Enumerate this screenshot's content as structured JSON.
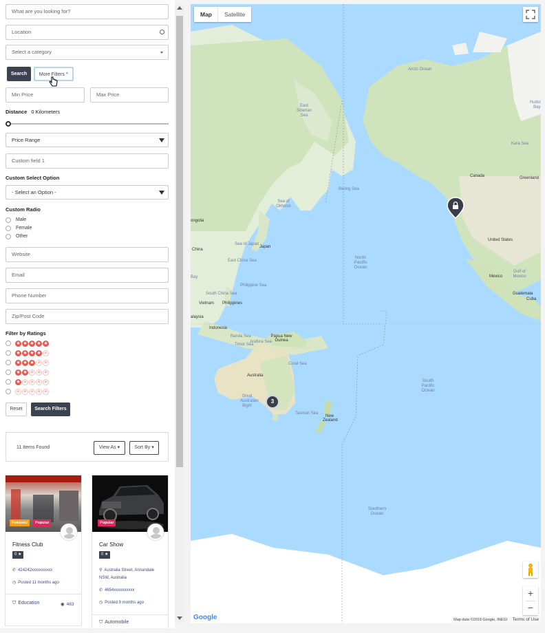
{
  "search": {
    "keyword_placeholder": "What are you looking for?",
    "location_placeholder": "Location",
    "category_placeholder": "Select a category",
    "search_label": "Search",
    "more_filters_label": "More Filters"
  },
  "filters": {
    "min_price_placeholder": "Min Price",
    "max_price_placeholder": "Max Price",
    "distance_label": "Distance",
    "distance_value": "0 Kilometers",
    "price_range_label": "Price Range",
    "custom_field_placeholder": "Custom field 1",
    "custom_select_heading": "Custom Select Option",
    "custom_select_value": "- Select an Option -",
    "custom_radio_heading": "Custom Radio",
    "radio_options": [
      "Male",
      "Female",
      "Other"
    ],
    "website_placeholder": "Website",
    "email_placeholder": "Email",
    "phone_placeholder": "Phone Number",
    "zip_placeholder": "Zip/Post Code",
    "ratings_heading": "Filter by Ratings",
    "ratings": [
      5,
      4,
      3,
      2,
      1,
      0
    ],
    "reset_label": "Reset",
    "search_filters_label": "Search Filters"
  },
  "results": {
    "count_text": "11 Items Found",
    "view_as_label": "View As",
    "sort_by_label": "Sort By"
  },
  "listings": [
    {
      "title": "Fitness Club",
      "badges": [
        "Featured",
        "Popular"
      ],
      "rating": "0",
      "phone": "424242xxxxxxxxxx",
      "posted": "Posted 11 months ago",
      "category": "Education",
      "views": "483"
    },
    {
      "title": "Car Show",
      "badges": [
        "Popular"
      ],
      "rating": "0",
      "address": "Australia Street, Annandale NSW, Australia",
      "phone": "4654xxxxxxxxxx",
      "posted": "Posted 9 months ago",
      "category": "Automobile"
    }
  ],
  "map": {
    "tab_map": "Map",
    "tab_satellite": "Satellite",
    "cluster_count": "3",
    "labels": {
      "arctic_ocean": "Arctic Ocean",
      "east_siberian_sea": "East Siberian Sea",
      "kara_sea": "Kara Sea",
      "bering_sea": "Bering Sea",
      "sea_of_okhotsk": "Sea of Okhotsk",
      "north_pacific_ocean": "North Pacific Ocean",
      "south_pacific_ocean": "South Pacific Ocean",
      "southern_ocean": "Southern Ocean",
      "canada": "Canada",
      "greenland": "Greenland",
      "united_states": "United States",
      "mexico": "Mexico",
      "gulf_of_mexico": "Gulf of Mexico",
      "guatemala": "Guatemala",
      "cuba": "Cuba",
      "hudson_bay": "Hudson Bay",
      "mongolia": "ongolia",
      "china": "China",
      "japan": "Japan",
      "sea_of_japan": "Sea of Japan",
      "east_china_sea": "East China Sea",
      "philippine_sea": "Philippine Sea",
      "philippines": "Philippines",
      "vietnam": "Vietnam",
      "south_china_sea": "South China Sea",
      "malaysia": "alaysia",
      "indonesia": "Indonesia",
      "banda_sea": "Banda Sea",
      "arafura_sea": "Arafura Sea",
      "papua_new_guinea": "Papua New Guinea",
      "coral_sea": "Coral Sea",
      "australia": "Australia",
      "great_australian_bight": "Great Australian Bight",
      "tasman_sea": "Tasman Sea",
      "new_zealand": "New Zealand",
      "timor_sea": "Timor Sea",
      "bay_of_bengal": "Bay"
    },
    "google": "Google",
    "map_data": "Map data ©2019 Google, INEGI",
    "terms": "Terms of Use"
  },
  "colors": {
    "dark_button": "#3c4250",
    "star_on": "#e25a52",
    "featured_badge": "#f4a01b",
    "popular_badge": "#e8245c",
    "water": "#aadaff"
  }
}
